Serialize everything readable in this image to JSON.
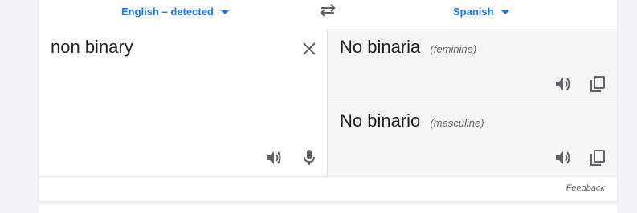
{
  "language_bar": {
    "source_label": "English – detected",
    "target_label": "Spanish"
  },
  "source": {
    "text": "non binary"
  },
  "translations": [
    {
      "word": "No binaria",
      "gender": "(feminine)"
    },
    {
      "word": "No binario",
      "gender": "(masculine)"
    }
  ],
  "footer": {
    "feedback_label": "Feedback"
  },
  "icons": {
    "swap": "swap-languages-icon",
    "clear": "close-icon",
    "listen": "speaker-icon",
    "mic": "microphone-icon",
    "copy": "copy-icon"
  },
  "colors": {
    "accent": "#1a73e8",
    "icon": "#5f6368",
    "text": "#202124",
    "target_bg": "#f5f5f5"
  }
}
